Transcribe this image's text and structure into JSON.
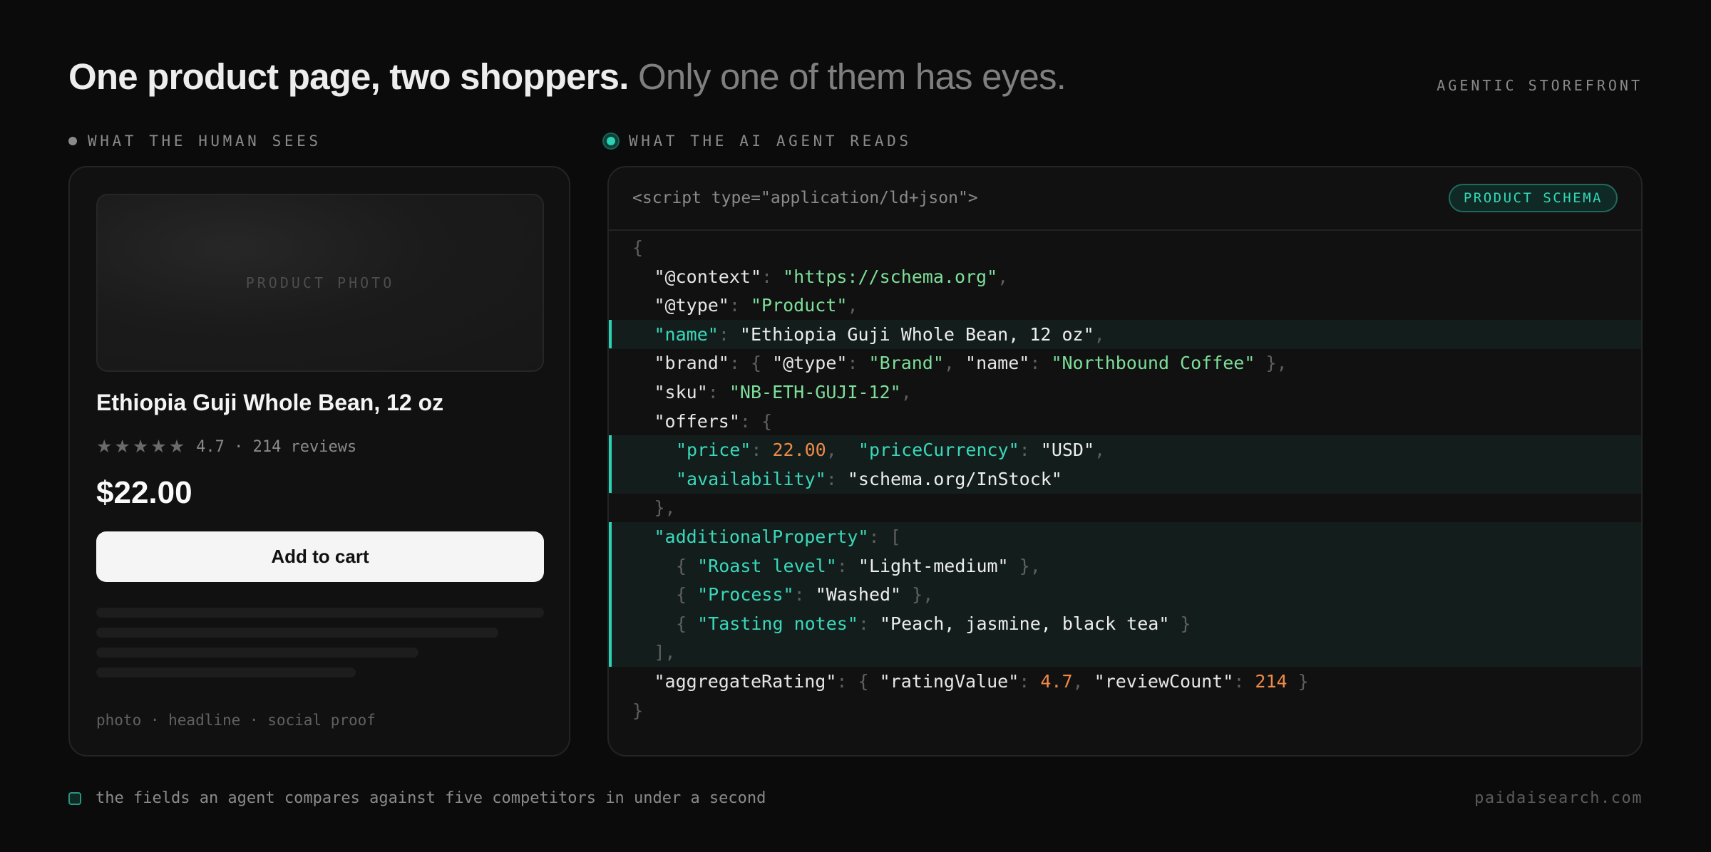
{
  "header": {
    "headline_bold": "One product page, two shoppers.",
    "headline_muted": "Only one of them has eyes.",
    "brand_tag": "AGENTIC STOREFRONT"
  },
  "columns": {
    "human_label": "WHAT THE HUMAN SEES",
    "agent_label": "WHAT THE AI AGENT READS"
  },
  "product_card": {
    "photo_placeholder": "PRODUCT PHOTO",
    "title": "Ethiopia Guji Whole Bean, 12 oz",
    "star_icon": "★",
    "stars_total": 5,
    "rating_text": "4.7 · 214 reviews",
    "price": "$22.00",
    "add_to_cart_label": "Add to cart",
    "caption": "photo · headline · social proof"
  },
  "code_panel": {
    "script_tag": "<script type=\"application/ld+json\">",
    "badge": "PRODUCT SCHEMA",
    "lines": [
      {
        "hl": false,
        "indent": 0,
        "tokens": [
          [
            "p",
            "{"
          ]
        ]
      },
      {
        "hl": false,
        "indent": 1,
        "tokens": [
          [
            "k",
            "\"@context\""
          ],
          [
            "p",
            ": "
          ],
          [
            "s",
            "\"https://schema.org\""
          ],
          [
            "p",
            ","
          ]
        ]
      },
      {
        "hl": false,
        "indent": 1,
        "tokens": [
          [
            "k",
            "\"@type\""
          ],
          [
            "p",
            ": "
          ],
          [
            "s",
            "\"Product\""
          ],
          [
            "p",
            ","
          ]
        ]
      },
      {
        "hl": true,
        "indent": 1,
        "tokens": [
          [
            "kt",
            "\"name\""
          ],
          [
            "p",
            ": "
          ],
          [
            "v",
            "\"Ethiopia Guji Whole Bean, 12 oz\""
          ],
          [
            "p",
            ","
          ]
        ]
      },
      {
        "hl": false,
        "indent": 1,
        "tokens": [
          [
            "k",
            "\"brand\""
          ],
          [
            "p",
            ": { "
          ],
          [
            "k",
            "\"@type\""
          ],
          [
            "p",
            ": "
          ],
          [
            "s",
            "\"Brand\""
          ],
          [
            "p",
            ", "
          ],
          [
            "k",
            "\"name\""
          ],
          [
            "p",
            ": "
          ],
          [
            "s",
            "\"Northbound Coffee\""
          ],
          [
            "p",
            " },"
          ]
        ]
      },
      {
        "hl": false,
        "indent": 1,
        "tokens": [
          [
            "k",
            "\"sku\""
          ],
          [
            "p",
            ": "
          ],
          [
            "s",
            "\"NB-ETH-GUJI-12\""
          ],
          [
            "p",
            ","
          ]
        ]
      },
      {
        "hl": false,
        "indent": 1,
        "tokens": [
          [
            "k",
            "\"offers\""
          ],
          [
            "p",
            ": {"
          ]
        ]
      },
      {
        "hl": true,
        "indent": 2,
        "tokens": [
          [
            "kt",
            "\"price\""
          ],
          [
            "p",
            ": "
          ],
          [
            "n",
            "22.00"
          ],
          [
            "p",
            ",  "
          ],
          [
            "kt",
            "\"priceCurrency\""
          ],
          [
            "p",
            ": "
          ],
          [
            "v",
            "\"USD\""
          ],
          [
            "p",
            ","
          ]
        ]
      },
      {
        "hl": true,
        "indent": 2,
        "tokens": [
          [
            "kt",
            "\"availability\""
          ],
          [
            "p",
            ": "
          ],
          [
            "v",
            "\"schema.org/InStock\""
          ]
        ]
      },
      {
        "hl": false,
        "indent": 1,
        "tokens": [
          [
            "p",
            "},"
          ]
        ]
      },
      {
        "hl": true,
        "indent": 1,
        "tokens": [
          [
            "kt",
            "\"additionalProperty\""
          ],
          [
            "p",
            ": ["
          ]
        ]
      },
      {
        "hl": true,
        "indent": 2,
        "tokens": [
          [
            "p",
            "{ "
          ],
          [
            "kt",
            "\"Roast level\""
          ],
          [
            "p",
            ": "
          ],
          [
            "v",
            "\"Light-medium\""
          ],
          [
            "p",
            " },"
          ]
        ]
      },
      {
        "hl": true,
        "indent": 2,
        "tokens": [
          [
            "p",
            "{ "
          ],
          [
            "kt",
            "\"Process\""
          ],
          [
            "p",
            ": "
          ],
          [
            "v",
            "\"Washed\""
          ],
          [
            "p",
            " },"
          ]
        ]
      },
      {
        "hl": true,
        "indent": 2,
        "tokens": [
          [
            "p",
            "{ "
          ],
          [
            "kt",
            "\"Tasting notes\""
          ],
          [
            "p",
            ": "
          ],
          [
            "v",
            "\"Peach, jasmine, black tea\""
          ],
          [
            "p",
            " }"
          ]
        ]
      },
      {
        "hl": true,
        "indent": 1,
        "tokens": [
          [
            "p",
            "],"
          ]
        ]
      },
      {
        "hl": false,
        "indent": 1,
        "tokens": [
          [
            "k",
            "\"aggregateRating\""
          ],
          [
            "p",
            ": { "
          ],
          [
            "k",
            "\"ratingValue\""
          ],
          [
            "p",
            ": "
          ],
          [
            "n",
            "4.7"
          ],
          [
            "p",
            ", "
          ],
          [
            "k",
            "\"reviewCount\""
          ],
          [
            "p",
            ": "
          ],
          [
            "n",
            "214"
          ],
          [
            "p",
            " }"
          ]
        ]
      },
      {
        "hl": false,
        "indent": 0,
        "tokens": [
          [
            "p",
            "}"
          ]
        ]
      }
    ]
  },
  "footer": {
    "legend_text": "the fields an agent compares against five competitors in under a second",
    "site": "paidaisearch.com"
  },
  "colors": {
    "accent": "#2ad3b4",
    "string": "#7ddf9a",
    "number": "#ef8a48",
    "background": "#0b0b0b"
  }
}
